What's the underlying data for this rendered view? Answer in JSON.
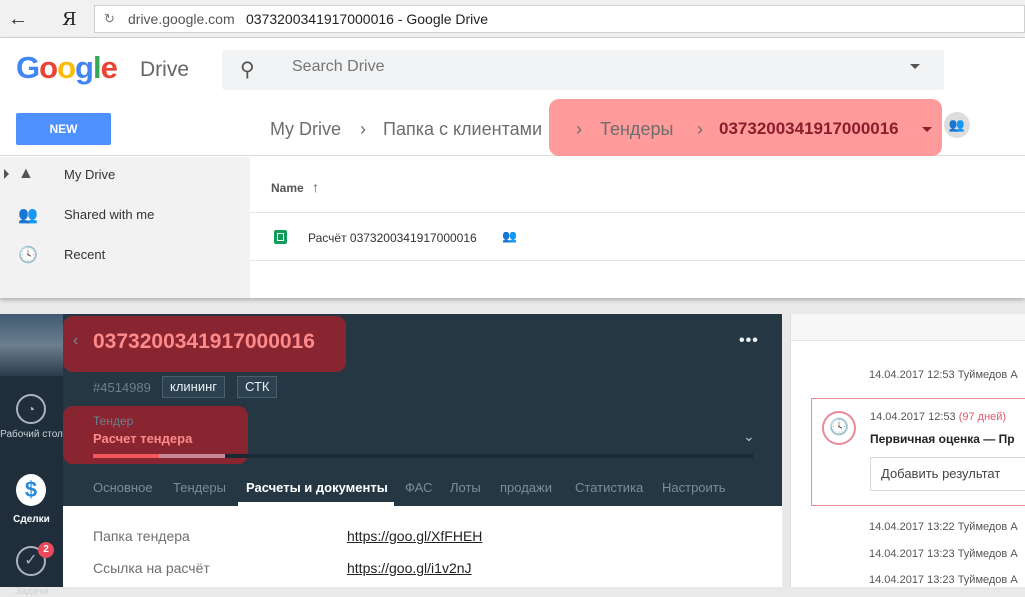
{
  "browser": {
    "back_glyph": "←",
    "logo": "Я",
    "reload_glyph": "↻",
    "domain": "drive.google.com",
    "title": "0373200341917000016 - Google Drive"
  },
  "drive": {
    "logo_letters": [
      {
        "ch": "G",
        "color": "#4285F4"
      },
      {
        "ch": "o",
        "color": "#EA4335"
      },
      {
        "ch": "o",
        "color": "#FBBC05"
      },
      {
        "ch": "g",
        "color": "#4285F4"
      },
      {
        "ch": "l",
        "color": "#34A853"
      },
      {
        "ch": "e",
        "color": "#EA4335"
      }
    ],
    "product": "Drive",
    "search_placeholder": "Search Drive",
    "new_button": "NEW",
    "breadcrumb": {
      "items": [
        "My Drive",
        "Папка с клиентами",
        "Тендеры"
      ],
      "separator": "›",
      "current": "0373200341917000016"
    },
    "sidebar": [
      {
        "label": "My Drive",
        "icon": "drive-icon",
        "glyph": "▲"
      },
      {
        "label": "Shared with me",
        "icon": "people-icon",
        "glyph": "👥"
      },
      {
        "label": "Recent",
        "icon": "clock-icon",
        "glyph": "🕓"
      }
    ],
    "files": {
      "column_name": "Name",
      "sort_glyph": "↑",
      "rows": [
        {
          "name": "Расчёт 0373200341917000016",
          "shared": true
        }
      ]
    },
    "accent": "#4d90fe"
  },
  "crm": {
    "nav": {
      "desktop_label": "Рабочий стол",
      "deals_label": "Сделки",
      "tasks_label": "Задачи",
      "tasks_badge": "2"
    },
    "deal": {
      "back_glyph": "‹",
      "title": "0373200341917000016",
      "more_glyph": "•••",
      "id": "#4514989",
      "tags": [
        "клининг",
        "СТК"
      ],
      "stage_caption": "Тендер",
      "stage_value": "Расчет тендера",
      "chevron": "⌄"
    },
    "tabs": [
      "Основное",
      "Тендеры",
      "Расчеты и документы",
      "ФАС",
      "Лоты",
      "продажи",
      "Статистика",
      "Настроить"
    ],
    "active_tab": "Расчеты и документы",
    "fields": [
      {
        "label": "Папка тендера",
        "value": "https://goo.gl/XfFHEH"
      },
      {
        "label": "Ссылка на расчёт",
        "value": "https://goo.gl/i1v2nJ"
      }
    ],
    "feed": {
      "lines_top": [
        "14.04.2017 12:53 Туймедов А"
      ],
      "card": {
        "timestamp": "14.04.2017 12:53",
        "days": "(97 дней)",
        "title": "Первичная оценка — Пр",
        "input_placeholder": "Добавить результат"
      },
      "lines_bottom": [
        "14.04.2017 13:22 Туймедов А",
        "14.04.2017 13:23 Туймедов А",
        "14.04.2017 13:23 Туймедов А"
      ]
    },
    "colors": {
      "highlight": "#8e2430",
      "title_text": "#ff8a8a",
      "header_bg": "#243743"
    }
  }
}
